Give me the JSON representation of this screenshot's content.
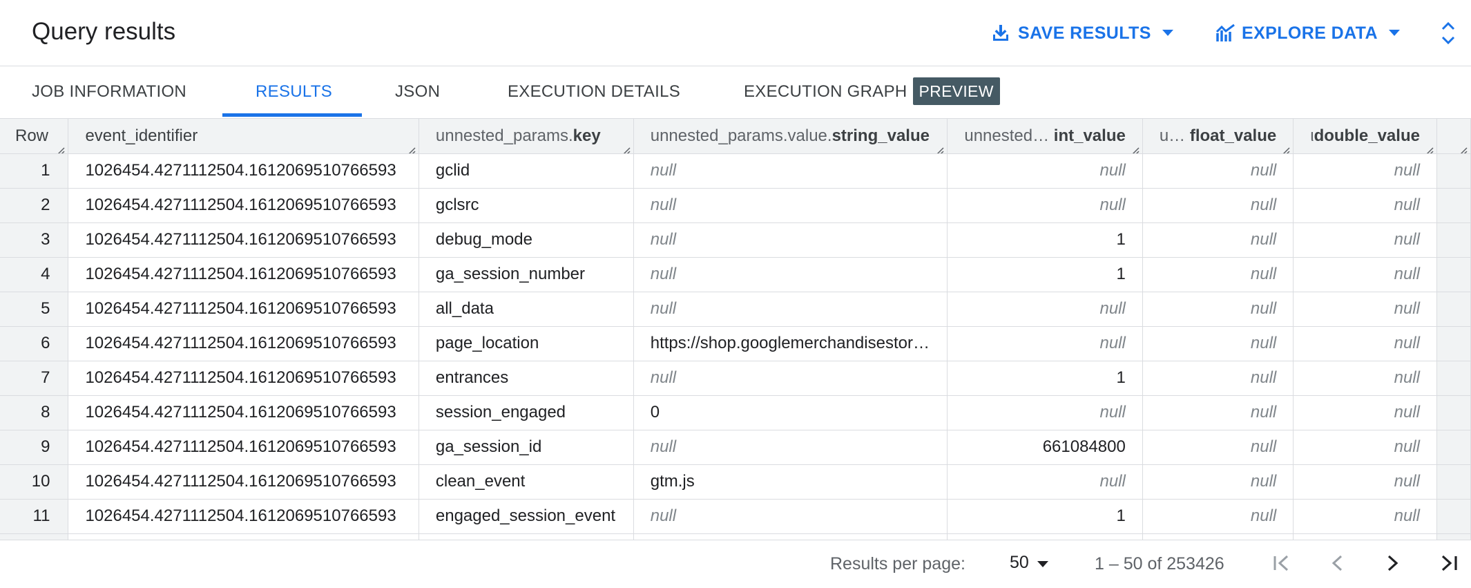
{
  "header": {
    "title": "Query results",
    "save_label": "SAVE RESULTS",
    "explore_label": "EXPLORE DATA"
  },
  "tabs": [
    {
      "label": "JOB INFORMATION"
    },
    {
      "label": "RESULTS"
    },
    {
      "label": "JSON"
    },
    {
      "label": "EXECUTION DETAILS"
    },
    {
      "label": "EXECUTION GRAPH"
    }
  ],
  "active_tab": "RESULTS",
  "preview_badge": "PREVIEW",
  "columns": [
    {
      "prefix": "",
      "name": "Row"
    },
    {
      "prefix": "",
      "name": "event_identifier"
    },
    {
      "prefix": "unnested_params.",
      "name": "key"
    },
    {
      "prefix": "unnested_params.value.",
      "name": "string_value"
    },
    {
      "prefix": "unnested… ",
      "name": "int_value"
    },
    {
      "prefix": "u… ",
      "name": "float_value"
    },
    {
      "prefix": "ι",
      "name": "double_value"
    }
  ],
  "rows": [
    {
      "row": "1",
      "event_identifier": "1026454.4271112504.1612069510766593",
      "key": "gclid",
      "string_value": "null",
      "int_value": "null",
      "float_value": "null",
      "double_value": "null"
    },
    {
      "row": "2",
      "event_identifier": "1026454.4271112504.1612069510766593",
      "key": "gclsrc",
      "string_value": "null",
      "int_value": "null",
      "float_value": "null",
      "double_value": "null"
    },
    {
      "row": "3",
      "event_identifier": "1026454.4271112504.1612069510766593",
      "key": "debug_mode",
      "string_value": "null",
      "int_value": "1",
      "float_value": "null",
      "double_value": "null"
    },
    {
      "row": "4",
      "event_identifier": "1026454.4271112504.1612069510766593",
      "key": "ga_session_number",
      "string_value": "null",
      "int_value": "1",
      "float_value": "null",
      "double_value": "null"
    },
    {
      "row": "5",
      "event_identifier": "1026454.4271112504.1612069510766593",
      "key": "all_data",
      "string_value": "null",
      "int_value": "null",
      "float_value": "null",
      "double_value": "null"
    },
    {
      "row": "6",
      "event_identifier": "1026454.4271112504.1612069510766593",
      "key": "page_location",
      "string_value": "https://shop.googlemerchandisestor…",
      "int_value": "null",
      "float_value": "null",
      "double_value": "null"
    },
    {
      "row": "7",
      "event_identifier": "1026454.4271112504.1612069510766593",
      "key": "entrances",
      "string_value": "null",
      "int_value": "1",
      "float_value": "null",
      "double_value": "null"
    },
    {
      "row": "8",
      "event_identifier": "1026454.4271112504.1612069510766593",
      "key": "session_engaged",
      "string_value": "0",
      "int_value": "null",
      "float_value": "null",
      "double_value": "null"
    },
    {
      "row": "9",
      "event_identifier": "1026454.4271112504.1612069510766593",
      "key": "ga_session_id",
      "string_value": "null",
      "int_value": "661084800",
      "float_value": "null",
      "double_value": "null"
    },
    {
      "row": "10",
      "event_identifier": "1026454.4271112504.1612069510766593",
      "key": "clean_event",
      "string_value": "gtm.js",
      "int_value": "null",
      "float_value": "null",
      "double_value": "null"
    },
    {
      "row": "11",
      "event_identifier": "1026454.4271112504.1612069510766593",
      "key": "engaged_session_event",
      "string_value": "null",
      "int_value": "1",
      "float_value": "null",
      "double_value": "null"
    }
  ],
  "footer": {
    "per_page_label": "Results per page:",
    "per_page_value": "50",
    "range": "1 – 50 of 253426"
  },
  "icons": {
    "save": "download-icon",
    "explore": "chart-icon",
    "collapse": "unfold-icon",
    "first": "first-page-icon",
    "prev": "chevron-left-icon",
    "next": "chevron-right-icon",
    "last": "last-page-icon"
  },
  "colors": {
    "accent": "#1a73e8",
    "badge_bg": "#455a64",
    "header_bg": "#f1f3f4"
  }
}
